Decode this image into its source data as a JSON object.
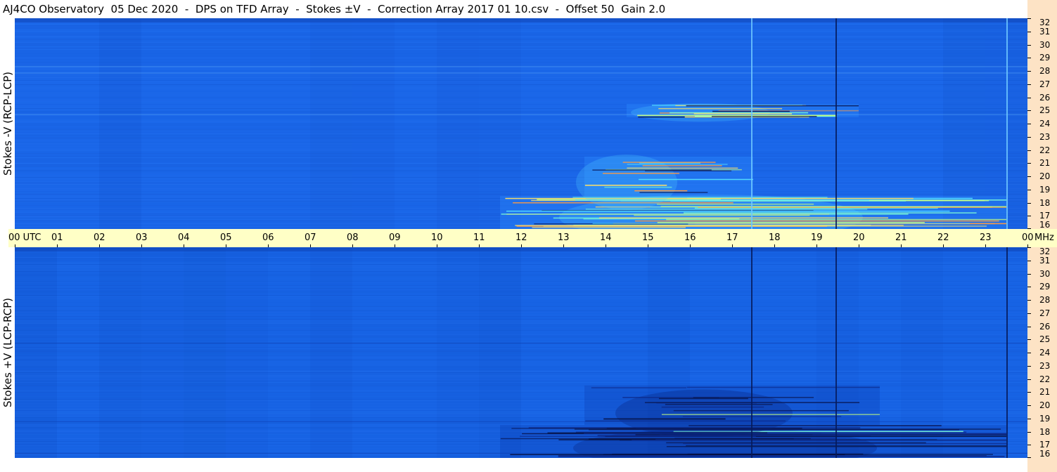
{
  "title": "AJ4CO Observatory  05 Dec 2020  -  DPS on TFD Array  -  Stokes ±V  -  Correction Array 2017 01 10.csv  -  Offset 50  Gain 2.0",
  "colors": {
    "background_blue": "#1a63e6",
    "axis_bg_time": "#ffffc6",
    "axis_bg_freq": "#fde3c5",
    "bright_emission": "#7fffd4",
    "dark_emission": "#0a1a5a"
  },
  "chart_data": [
    {
      "type": "heatmap",
      "name": "top-panel",
      "ylabel": "Stokes -V (RCP-LCP)",
      "y_unit": "MHz",
      "ylim": [
        16,
        32
      ],
      "y_ticks": [
        "32",
        "31",
        "30",
        "29",
        "28",
        "27",
        "26",
        "25",
        "24",
        "23",
        "22",
        "21",
        "20",
        "19",
        "18",
        "17",
        "16"
      ],
      "xlim": [
        0,
        24
      ],
      "emission": "bright",
      "bursts": [
        {
          "t_start": 11.5,
          "t_end": 23.5,
          "f_low": 16.0,
          "f_high": 18.5
        },
        {
          "t_start": 13.5,
          "t_end": 17.5,
          "f_low": 18.5,
          "f_high": 21.5
        },
        {
          "t_start": 14.5,
          "t_end": 20.0,
          "f_low": 24.5,
          "f_high": 25.5
        }
      ],
      "vertical_lines": [
        {
          "t": 17.45,
          "style": "bright"
        },
        {
          "t": 19.45,
          "style": "dark"
        },
        {
          "t": 23.5,
          "style": "bright"
        }
      ]
    },
    {
      "type": "heatmap",
      "name": "bottom-panel",
      "ylabel": "Stokes +V (LCP-RCP)",
      "y_unit": "MHz",
      "ylim": [
        16,
        32
      ],
      "y_ticks": [
        "32",
        "31",
        "30",
        "29",
        "28",
        "27",
        "26",
        "25",
        "24",
        "23",
        "22",
        "21",
        "20",
        "19",
        "18",
        "17",
        "16"
      ],
      "xlim": [
        0,
        24
      ],
      "emission": "dark",
      "bursts": [
        {
          "t_start": 11.5,
          "t_end": 23.5,
          "f_low": 16.0,
          "f_high": 18.5
        },
        {
          "t_start": 13.5,
          "t_end": 20.5,
          "f_low": 18.5,
          "f_high": 21.5
        }
      ],
      "vertical_lines": [
        {
          "t": 17.45,
          "style": "dark"
        },
        {
          "t": 19.45,
          "style": "dark"
        },
        {
          "t": 23.5,
          "style": "dark"
        }
      ]
    }
  ],
  "time_axis": {
    "labels": [
      "00  UTC",
      "01",
      "02",
      "03",
      "04",
      "05",
      "06",
      "07",
      "08",
      "09",
      "10",
      "11",
      "12",
      "13",
      "14",
      "15",
      "16",
      "17",
      "18",
      "19",
      "20",
      "21",
      "22",
      "23",
      "00"
    ],
    "unit": "MHz"
  }
}
